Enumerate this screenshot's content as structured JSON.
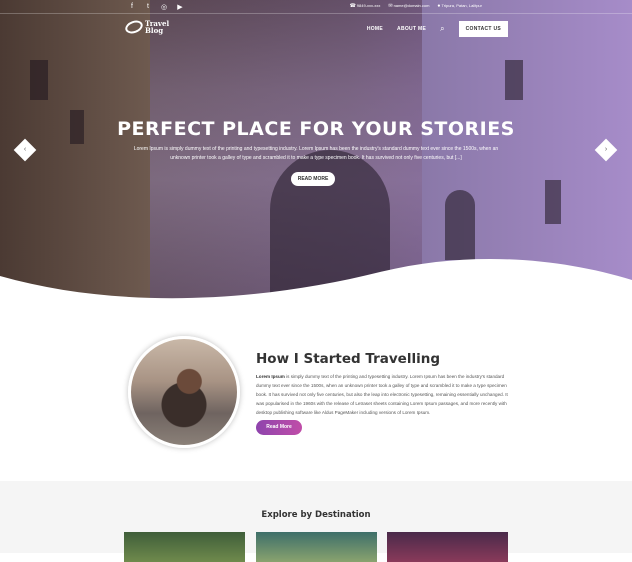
{
  "topbar": {
    "social_icons": [
      "facebook-icon",
      "twitter-icon",
      "instagram-icon",
      "youtube-icon"
    ],
    "phone": "9849-xxx-xxx",
    "email": "name@domain.com",
    "location": "Tripura, Patan, Lalitpur"
  },
  "nav": {
    "logo_line1": "Travel",
    "logo_line2": "Blog",
    "home": "HOME",
    "about": "ABOUT ME",
    "contact_button": "CONTACT US"
  },
  "hero": {
    "title": "PERFECT PLACE FOR YOUR STORIES",
    "description": "Lorem Ipsum is simply dummy text of the printing and typesetting industry. Lorem Ipsum has been the industry's standard dummy text ever since the 1500s, when an unknown printer took a galley of type and scrambled it to make a type specimen book. It has survived not only five centuries, but [...]",
    "button": "READ MORE",
    "prev_symbol": "‹",
    "next_symbol": "›"
  },
  "about": {
    "title": "How I Started Travelling",
    "lead": "Lorem Ipsum",
    "body": " is simply dummy text of the printing and typesetting industry. Lorem Ipsum has been the industry's standard dummy text ever since the 1500s, when an unknown printer took a galley of type and scrambled it to make a type specimen book. It has survived not only five centuries, but also the leap into electronic typesetting, remaining essentially unchanged. It was popularised in the 1960s with the release of Letraset sheets containing Lorem Ipsum passages, and more recently with desktop publishing software like Aldus PageMaker including versions of Lorem Ipsum.",
    "button": "Read More"
  },
  "destination": {
    "title": "Explore by Destination"
  },
  "colors": {
    "accent_gradient_start": "#8e44ad",
    "accent_gradient_end": "#c04da8",
    "hero_overlay": "#a68cc9"
  }
}
